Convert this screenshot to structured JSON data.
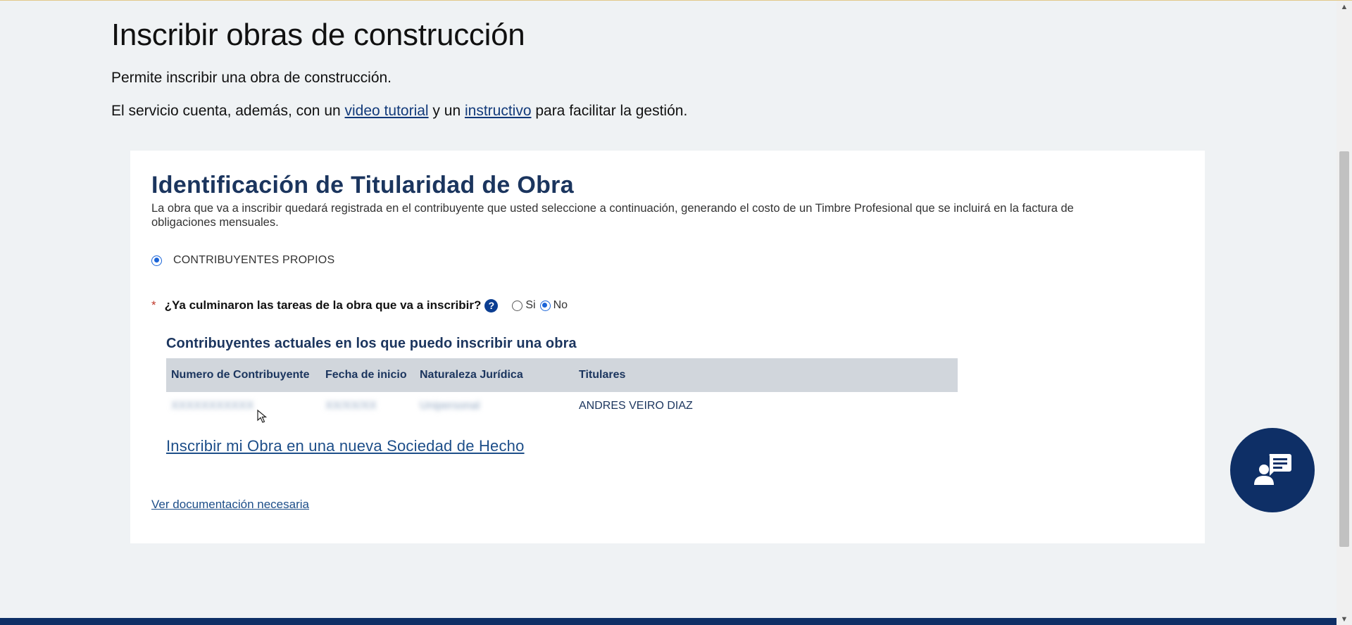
{
  "header": {
    "title": "Inscribir obras de construcción",
    "description": "Permite inscribir una obra de construcción.",
    "service_prefix": "El servicio cuenta, además, con un ",
    "video_link": "video tutorial",
    "service_mid": " y un ",
    "instructivo_link": "instructivo",
    "service_suffix": " para facilitar la gestión."
  },
  "card": {
    "title": "Identificación de Titularidad de Obra",
    "description": "La obra que va a inscribir quedará registrada en el contribuyente que usted seleccione a continuación, generando el costo de un Timbre Profesional que se incluirá en la factura de obligaciones mensuales.",
    "contribuyentes_option": "CONTRIBUYENTES PROPIOS",
    "question": {
      "required_mark": "*",
      "text": "¿Ya culminaron las tareas de la obra que va a inscribir?",
      "help_glyph": "?",
      "option_yes": "Si",
      "option_no": "No",
      "selected": "No"
    },
    "table": {
      "title": "Contribuyentes actuales en los que puedo inscribir una obra",
      "headers": [
        "Numero de Contribuyente",
        "Fecha de inicio",
        "Naturaleza Jurídica",
        "Titulares"
      ],
      "rows": [
        {
          "numero": "XXXXXXXXXXX",
          "fecha": "XX/XX/XX",
          "naturaleza": "Unipersonal",
          "titulares": "ANDRES VEIRO DIAZ"
        }
      ]
    },
    "new_society_link": "Inscribir mi Obra en una nueva Sociedad de Hecho",
    "documentation_link": "Ver documentación necesaria"
  },
  "colors": {
    "primary": "#0e2f66",
    "heading": "#1b355e",
    "link": "#1d4e89",
    "background": "#eff2f4",
    "table_header": "#d1d6dc"
  },
  "icons": {
    "fab": "chat-support-icon",
    "help": "help-icon",
    "cursor": "mouse-pointer-icon"
  }
}
